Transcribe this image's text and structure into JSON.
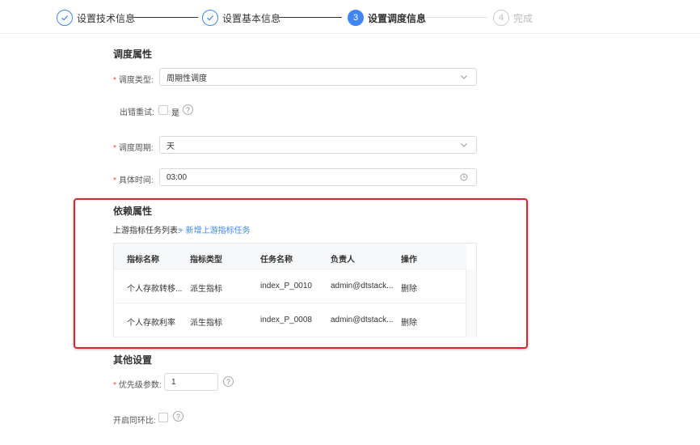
{
  "steps": [
    {
      "index": "1",
      "label": "设置技术信息",
      "state": "done"
    },
    {
      "index": "2",
      "label": "设置基本信息",
      "state": "done"
    },
    {
      "index": "3",
      "label": "设置调度信息",
      "state": "active"
    },
    {
      "index": "4",
      "label": "完成",
      "state": "todo"
    }
  ],
  "schedule": {
    "title": "调度属性",
    "type_label": "调度类型:",
    "type_value": "周期性调度",
    "retry_label": "出错重试:",
    "retry_option": "是",
    "period_label": "调度周期:",
    "period_value": "天",
    "time_label": "具体时间:",
    "time_value": "03:00"
  },
  "dependency": {
    "title": "依赖属性",
    "list_label": "上游指标任务列表:",
    "add_link": "+ 新增上游指标任务",
    "columns": [
      "指标名称",
      "指标类型",
      "任务名称",
      "负责人",
      "操作"
    ],
    "rows": [
      {
        "name": "个人存款转移...",
        "type": "派生指标",
        "task": "index_P_0010",
        "owner": "admin@dtstack...",
        "action": "删除"
      },
      {
        "name": "个人存款利率",
        "type": "派生指标",
        "task": "index_P_0008",
        "owner": "admin@dtstack...",
        "action": "删除"
      }
    ]
  },
  "other": {
    "title": "其他设置",
    "priority_label": "优先级参数:",
    "priority_value": "1",
    "cycle_label": "开启同环比:"
  },
  "colors": {
    "accent": "#3f87f5",
    "highlight": "#e0232b",
    "required": "#f04134"
  }
}
